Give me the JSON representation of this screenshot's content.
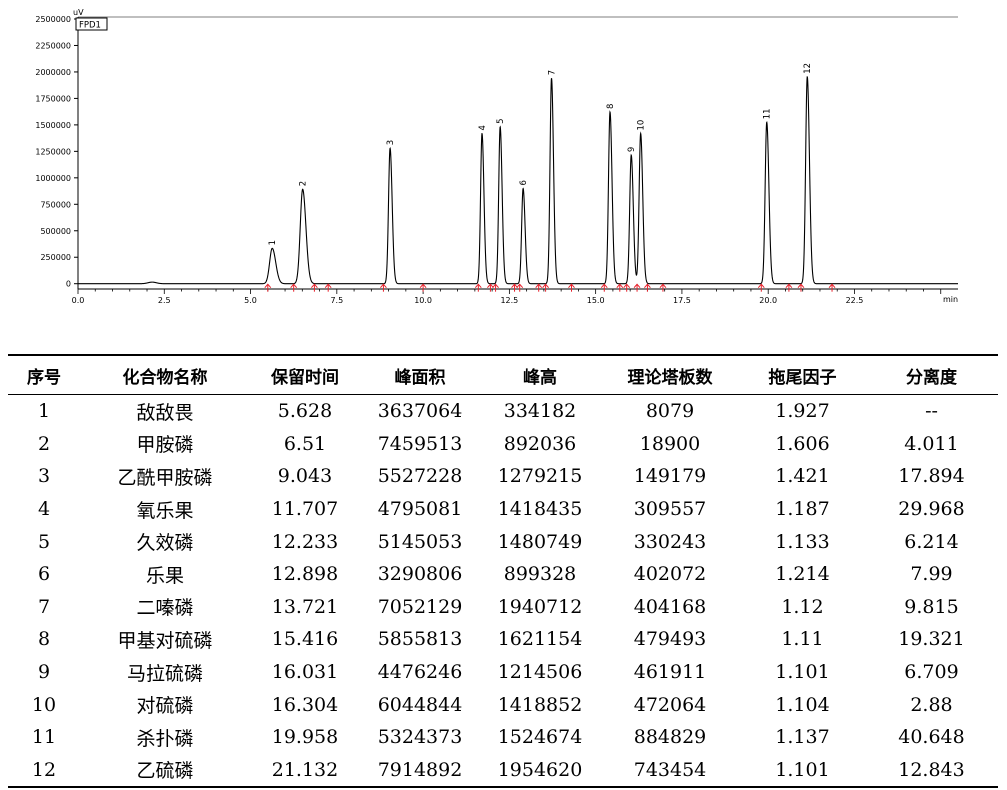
{
  "chart_data": {
    "type": "line",
    "title": "",
    "detector_label": "FPD1",
    "xlabel": "min",
    "ylabel": "uV",
    "xlim": [
      0,
      25.5
    ],
    "ylim": [
      -50000,
      2500000
    ],
    "x_ticks": [
      "0.0",
      "2.5",
      "5.0",
      "7.5",
      "10.0",
      "12.5",
      "15.0",
      "17.5",
      "20.0",
      "22.5"
    ],
    "y_ticks": [
      "0",
      "250000",
      "500000",
      "750000",
      "1000000",
      "1250000",
      "1500000",
      "1750000",
      "2000000",
      "2250000",
      "2500000"
    ],
    "line_color": "#000000",
    "marker_color": "#e8202a",
    "grid": false,
    "peaks": [
      {
        "label": "1",
        "rt": 5.628,
        "height": 334182
      },
      {
        "label": "2",
        "rt": 6.51,
        "height": 892036
      },
      {
        "label": "3",
        "rt": 9.043,
        "height": 1279215
      },
      {
        "label": "4",
        "rt": 11.707,
        "height": 1418435
      },
      {
        "label": "5",
        "rt": 12.233,
        "height": 1480749
      },
      {
        "label": "6",
        "rt": 12.898,
        "height": 899328
      },
      {
        "label": "7",
        "rt": 13.721,
        "height": 1940712
      },
      {
        "label": "8",
        "rt": 15.416,
        "height": 1621154
      },
      {
        "label": "9",
        "rt": 16.031,
        "height": 1214506
      },
      {
        "label": "10",
        "rt": 16.304,
        "height": 1418852
      },
      {
        "label": "11",
        "rt": 19.958,
        "height": 1524674
      },
      {
        "label": "12",
        "rt": 21.132,
        "height": 1954620
      }
    ],
    "integration_marks": [
      5.5,
      6.25,
      6.85,
      7.25,
      8.85,
      10.0,
      11.6,
      11.95,
      12.1,
      12.65,
      12.8,
      13.35,
      13.55,
      14.3,
      15.25,
      15.7,
      15.9,
      16.2,
      16.5,
      16.95,
      19.8,
      20.6,
      20.95,
      21.85
    ]
  },
  "table": {
    "headers": [
      "序号",
      "化合物名称",
      "保留时间",
      "峰面积",
      "峰高",
      "理论塔板数",
      "拖尾因子",
      "分离度"
    ],
    "rows": [
      [
        "1",
        "敌敌畏",
        "5.628",
        "3637064",
        "334182",
        "8079",
        "1.927",
        "--"
      ],
      [
        "2",
        "甲胺磷",
        "6.51",
        "7459513",
        "892036",
        "18900",
        "1.606",
        "4.011"
      ],
      [
        "3",
        "乙酰甲胺磷",
        "9.043",
        "5527228",
        "1279215",
        "149179",
        "1.421",
        "17.894"
      ],
      [
        "4",
        "氧乐果",
        "11.707",
        "4795081",
        "1418435",
        "309557",
        "1.187",
        "29.968"
      ],
      [
        "5",
        "久效磷",
        "12.233",
        "5145053",
        "1480749",
        "330243",
        "1.133",
        "6.214"
      ],
      [
        "6",
        "乐果",
        "12.898",
        "3290806",
        "899328",
        "402072",
        "1.214",
        "7.99"
      ],
      [
        "7",
        "二嗪磷",
        "13.721",
        "7052129",
        "1940712",
        "404168",
        "1.12",
        "9.815"
      ],
      [
        "8",
        "甲基对硫磷",
        "15.416",
        "5855813",
        "1621154",
        "479493",
        "1.11",
        "19.321"
      ],
      [
        "9",
        "马拉硫磷",
        "16.031",
        "4476246",
        "1214506",
        "461911",
        "1.101",
        "6.709"
      ],
      [
        "10",
        "对硫磷",
        "16.304",
        "6044844",
        "1418852",
        "472064",
        "1.104",
        "2.88"
      ],
      [
        "11",
        "杀扑磷",
        "19.958",
        "5324373",
        "1524674",
        "884829",
        "1.137",
        "40.648"
      ],
      [
        "12",
        "乙硫磷",
        "21.132",
        "7914892",
        "1954620",
        "743454",
        "1.101",
        "12.843"
      ]
    ]
  }
}
